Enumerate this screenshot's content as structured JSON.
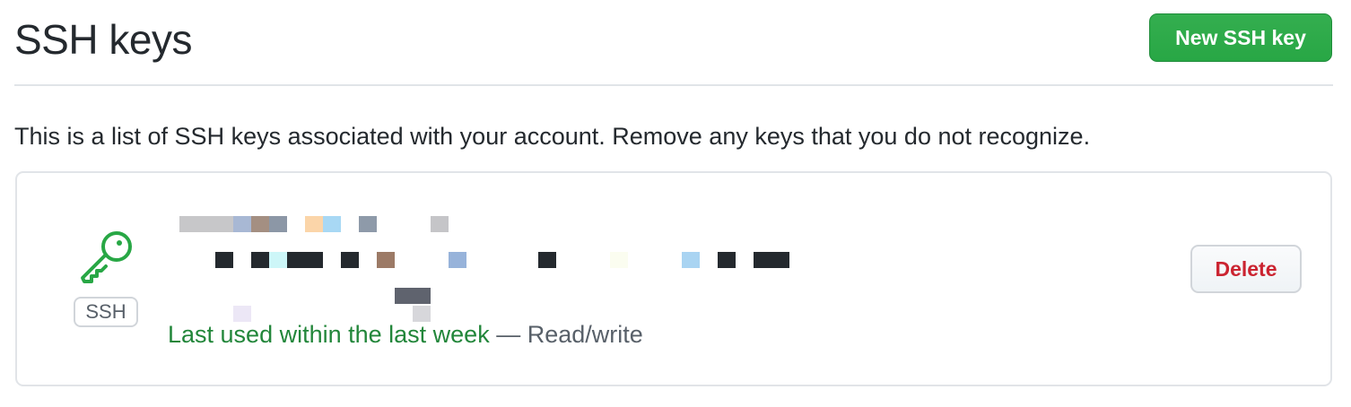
{
  "header": {
    "title": "SSH keys",
    "new_key_label": "New SSH key"
  },
  "intro": "This is a list of SSH keys associated with your account. Remove any keys that you do not recognize.",
  "keys": [
    {
      "type_badge": "SSH",
      "icon": "key-icon",
      "last_used": "Last used within the last week",
      "separator": " — ",
      "access": "Read/write",
      "delete_label": "Delete",
      "title_redacted": true,
      "fingerprint_redacted": true
    }
  ],
  "colors": {
    "primary_green": "#28a745",
    "danger_red": "#cb2431",
    "border": "#e1e4e8",
    "text": "#24292e",
    "muted_text": "#586069"
  }
}
